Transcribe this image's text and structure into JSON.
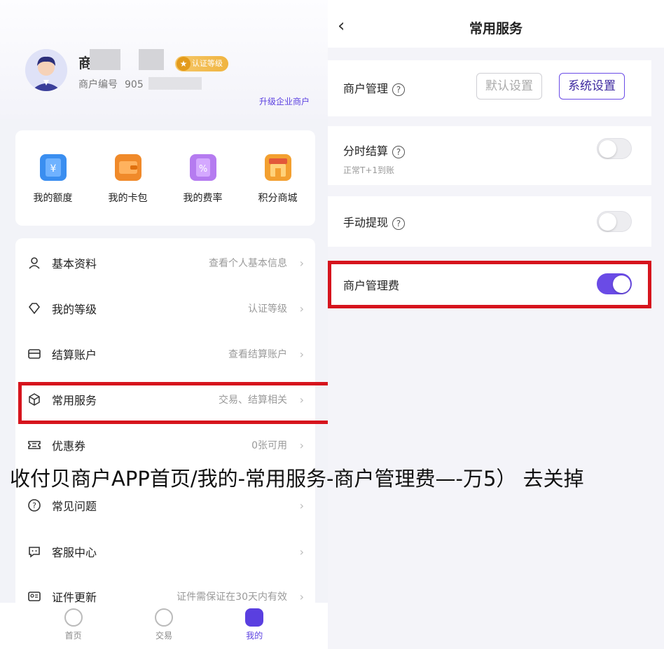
{
  "left": {
    "profile": {
      "name_fragment": "商",
      "badge": "认证等级",
      "merchant_no_label": "商户编号",
      "merchant_no": "905",
      "upgrade": "升级企业商户"
    },
    "quick": [
      {
        "label": "我的额度",
        "icon": "yen-wallet-icon",
        "color": "#3a8ef0"
      },
      {
        "label": "我的卡包",
        "icon": "wallet-icon",
        "color": "#f08a2a"
      },
      {
        "label": "我的费率",
        "icon": "percent-icon",
        "color": "#b57bf0"
      },
      {
        "label": "积分商城",
        "icon": "shop-icon",
        "color": "#f3a030"
      }
    ],
    "menu": [
      {
        "label": "基本资料",
        "value": "查看个人基本信息"
      },
      {
        "label": "我的等级",
        "value": "认证等级"
      },
      {
        "label": "结算账户",
        "value": "查看结算账户"
      },
      {
        "label": "常用服务",
        "value": "交易、结算相关"
      },
      {
        "label": "优惠券",
        "value": "0张可用"
      },
      {
        "label": "常见问题",
        "value": ""
      },
      {
        "label": "客服中心",
        "value": ""
      },
      {
        "label": "证件更新",
        "value": "证件需保证在30天内有效"
      }
    ],
    "tabs": [
      {
        "label": "首页",
        "active": false
      },
      {
        "label": "交易",
        "active": false
      },
      {
        "label": "我的",
        "active": true
      }
    ]
  },
  "right": {
    "title": "常用服务",
    "merchant_manage": {
      "label": "商户管理",
      "btn_default": "默认设置",
      "btn_system": "系统设置"
    },
    "timeshare": {
      "label": "分时结算",
      "sub": "正常T+1到账",
      "on": false
    },
    "manual_withdraw": {
      "label": "手动提现",
      "on": false
    },
    "merchant_fee": {
      "label": "商户管理费",
      "on": true
    }
  },
  "caption": "收付贝商户APP首页/我的-常用服务-商户管理费—-万5） 去关掉",
  "colors": {
    "accent": "#6a4be6",
    "highlight": "#d6141d"
  }
}
